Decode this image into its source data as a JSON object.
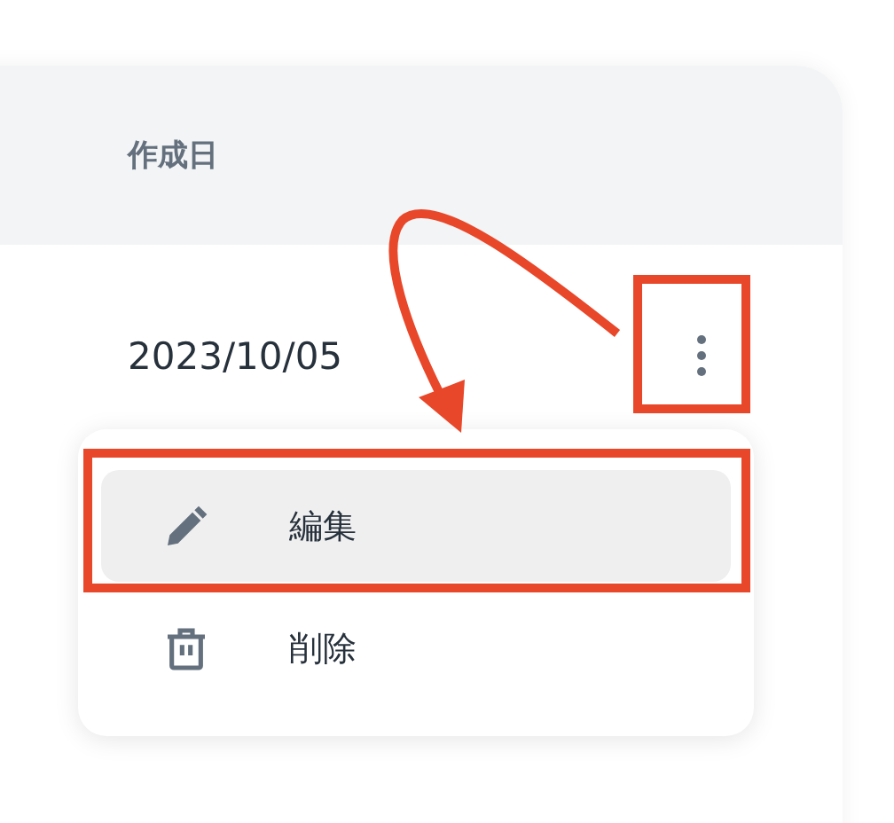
{
  "table": {
    "columns": [
      "作成日"
    ],
    "rows": [
      {
        "created": "2023/10/05"
      }
    ]
  },
  "menu": {
    "items": [
      {
        "kind": "edit",
        "label": "編集",
        "highlighted": true
      },
      {
        "kind": "delete",
        "label": "削除",
        "highlighted": false
      }
    ]
  }
}
